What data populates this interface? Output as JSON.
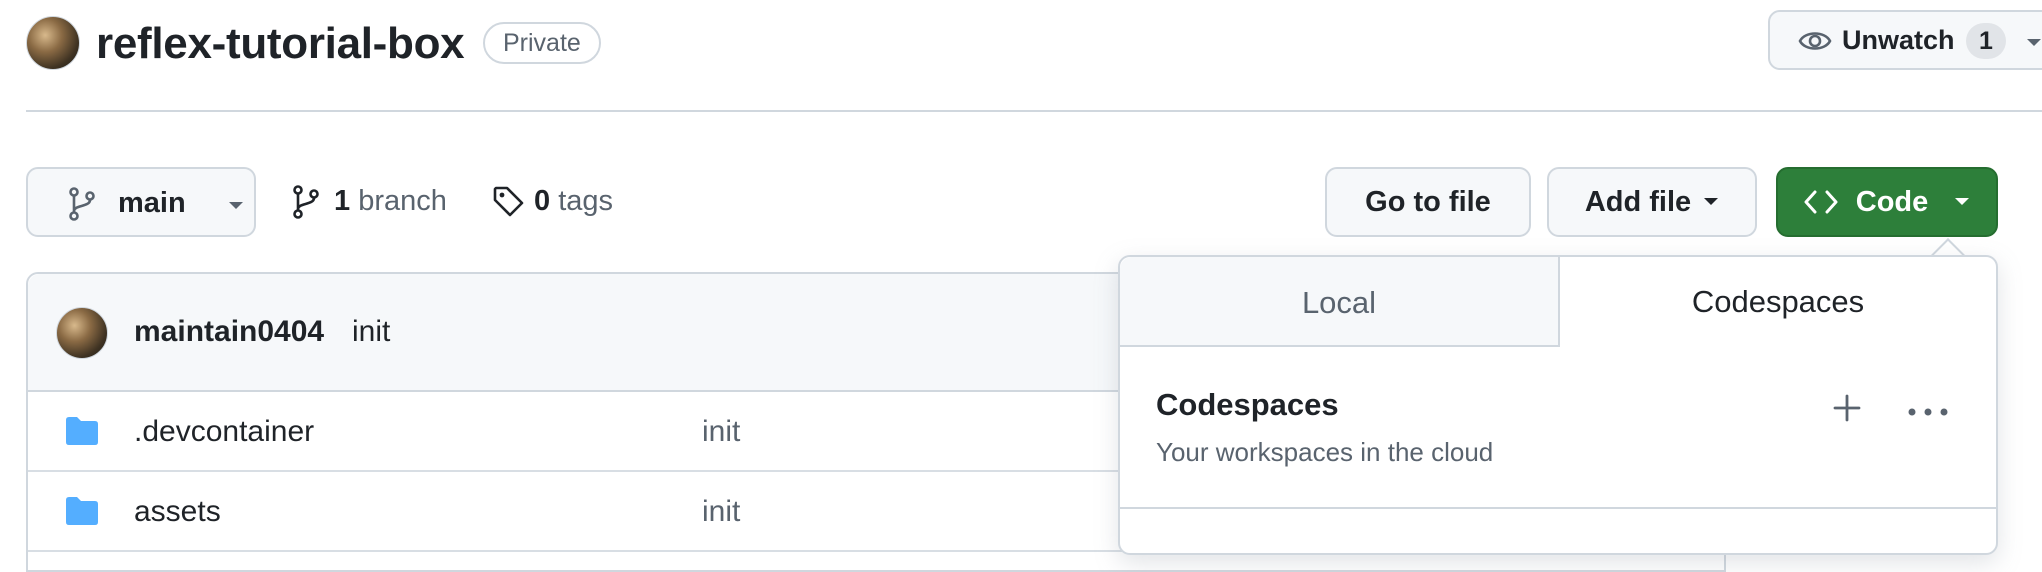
{
  "repo": {
    "name": "reflex-tutorial-box",
    "visibility": "Private"
  },
  "watch": {
    "label": "Unwatch",
    "count": "1"
  },
  "toolbar": {
    "branch": "main",
    "branch_count": "1",
    "branch_label": "branch",
    "tag_count": "0",
    "tag_label": "tags",
    "goto_file": "Go to file",
    "add_file": "Add file",
    "code": "Code"
  },
  "latest_commit": {
    "author": "maintain0404",
    "message": "init"
  },
  "files": [
    {
      "name": ".devcontainer",
      "message": "init",
      "icon": "folder-icon"
    },
    {
      "name": "assets",
      "message": "init",
      "icon": "folder-icon"
    }
  ],
  "code_dropdown": {
    "tabs": [
      "Local",
      "Codespaces"
    ],
    "active_tab": "Codespaces",
    "section_title": "Codespaces",
    "section_subtitle": "Your workspaces in the cloud"
  },
  "colors": {
    "code_button": "#2d7f3a",
    "folder": "#54aeff",
    "border": "#d0d7de",
    "muted_text": "#59636e"
  }
}
